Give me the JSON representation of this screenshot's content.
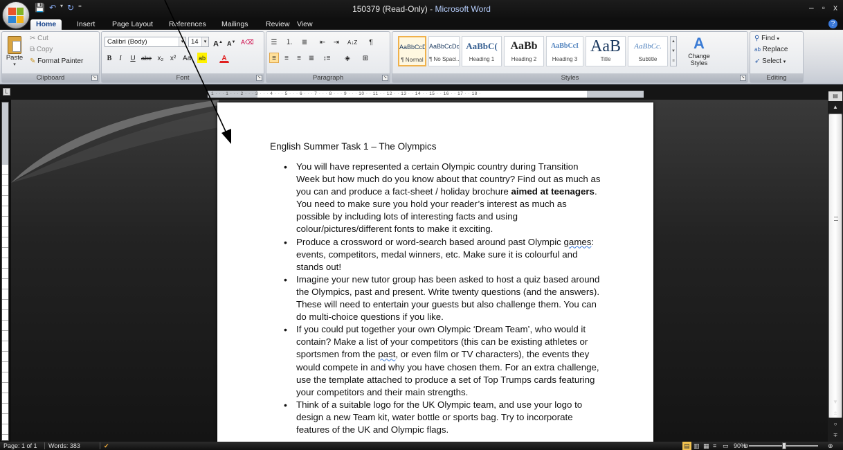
{
  "titlebar": {
    "document_name": "150379 (Read-Only)",
    "separator": " - ",
    "app_name": "Microsoft Word",
    "controls": {
      "minimize": "–",
      "restore": "▫",
      "close": "x"
    }
  },
  "quick_access": {
    "save_icon": "save-icon",
    "undo_icon": "undo-icon",
    "redo_icon": "redo-icon",
    "customize_icon": "customize-icon"
  },
  "tabs": [
    {
      "label": "Home"
    },
    {
      "label": "Insert"
    },
    {
      "label": "Page Layout"
    },
    {
      "label": "References"
    },
    {
      "label": "Mailings"
    },
    {
      "label": "Review"
    },
    {
      "label": "View"
    }
  ],
  "help": "?",
  "clipboard": {
    "paste": "Paste",
    "cut": "Cut",
    "copy": "Copy",
    "format_painter": "Format Painter",
    "label": "Clipboard"
  },
  "font": {
    "family": "Calibri (Body)",
    "size": "14",
    "grow": "A",
    "shrink": "A",
    "bold": "B",
    "italic": "I",
    "underline": "U",
    "strike": "abe",
    "subscript": "x₂",
    "superscript": "x²",
    "case": "Aa",
    "highlight": "ab",
    "color": "A",
    "label": "Font"
  },
  "paragraph": {
    "label": "Paragraph",
    "pilcrow": "¶"
  },
  "styles": {
    "label": "Styles",
    "items": [
      {
        "preview": "AaBbCcDc",
        "name": "¶ Normal"
      },
      {
        "preview": "AaBbCcDc",
        "name": "¶ No Spaci..."
      },
      {
        "preview": "AaBbC(",
        "name": "Heading 1"
      },
      {
        "preview": "AaBb",
        "name": "Heading 2"
      },
      {
        "preview": "AaBbCcI",
        "name": "Heading 3"
      },
      {
        "preview": "AaB",
        "name": "Title"
      },
      {
        "preview": "AaBbCc.",
        "name": "Subtitle"
      }
    ],
    "change_styles": "Change Styles"
  },
  "editing": {
    "label": "Editing",
    "find": "Find",
    "replace": "Replace",
    "select": "Select"
  },
  "ruler": {
    "numbers": "· 1 · · · 1 · · · 2 · · · 3 · · · 4 · · · 5 · · · 6 · · · 7 · · · 8 · · · 9 · · · 10 · · 11 · · 12 · · 13 · · 14 · · 15 · · 16 · · 17 · · 18 ·"
  },
  "tab_selector": "L",
  "document": {
    "heading": "English Summer Task 1 – The Olympics",
    "bullets": [
      {
        "before": "You will have represented a certain Olympic country during Transition Week but how much do you know about that country? Find out as much as you can and produce a fact-sheet / holiday brochure ",
        "bold": "aimed at teenagers",
        "after": ". You need to make sure you hold your reader’s interest as much as possible by including lots of interesting facts and using colour/pictures/different fonts to make it exciting."
      },
      {
        "before": "Produce a crossword or word-search based around past Olympic ",
        "squiggle": "games",
        "after": ": events, competitors, medal winners, etc.  Make sure it is colourful and stands out!"
      },
      {
        "before": "Imagine your new tutor group has been asked to host a quiz based around the Olympics, past and present. Write twenty questions (and the answers). These will need to entertain your guests but also challenge them. You can do multi-choice questions if you like."
      },
      {
        "before": "If you could put together your own Olympic ‘Dream Team’, who would it contain? Make a list of your competitors (this can be existing athletes or sportsmen from the ",
        "squiggle": "past",
        "after": ", or even film or TV characters), the events they would compete in and why you have chosen them.  For an extra challenge, use the template attached to produce a set of Top Trumps cards featuring your competitors and their main strengths."
      },
      {
        "before": "Think of a suitable logo for the UK Olympic team, and use your logo to design a new Team kit, water bottle or sports bag. Try to incorporate features of the UK and Olympic flags."
      }
    ]
  },
  "statusbar": {
    "page": "Page: 1 of 1",
    "words": "Words: 383",
    "zoom": "90%"
  }
}
